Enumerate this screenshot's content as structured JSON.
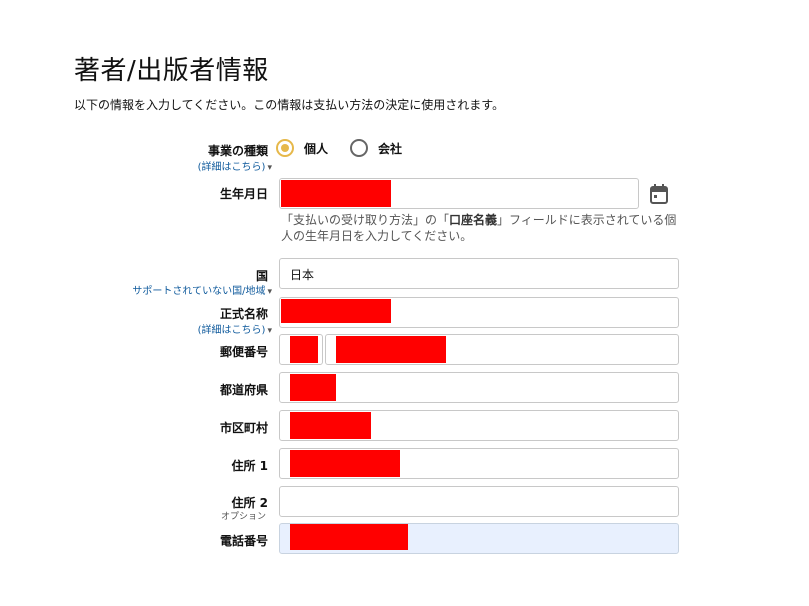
{
  "page": {
    "title": "著者/出版者情報",
    "subtitle": "以下の情報を入力してください。この情報は支払い方法の決定に使用されます。"
  },
  "business_type": {
    "label": "事業の種類",
    "details_link": "(詳細はこちら)",
    "options": [
      {
        "label": "個人",
        "checked": true
      },
      {
        "label": "会社",
        "checked": false
      }
    ],
    "accent_color": "#e6b84a"
  },
  "birthdate": {
    "label": "生年月日",
    "hint_pre": "「支払いの受け取り方法」の「",
    "hint_bold": "口座名義",
    "hint_post": "」フィールドに表示されている個人の生年月日を入力してください。",
    "calendar_icon": "calendar-icon"
  },
  "country": {
    "label": "国",
    "unsupported_link": "サポートされていない国/地域",
    "value": "日本"
  },
  "legal_name": {
    "label": "正式名称",
    "details_link": "(詳細はこちら)"
  },
  "postal_code": {
    "label": "郵便番号"
  },
  "prefecture": {
    "label": "都道府県"
  },
  "city": {
    "label": "市区町村"
  },
  "address1": {
    "label": "住所 1"
  },
  "address2": {
    "label": "住所 2",
    "note": "オプション"
  },
  "phone": {
    "label": "電話番号"
  },
  "colors": {
    "link": "#0f5a9c",
    "redaction": "#ff0000",
    "autofill": "#e8f0fe"
  }
}
